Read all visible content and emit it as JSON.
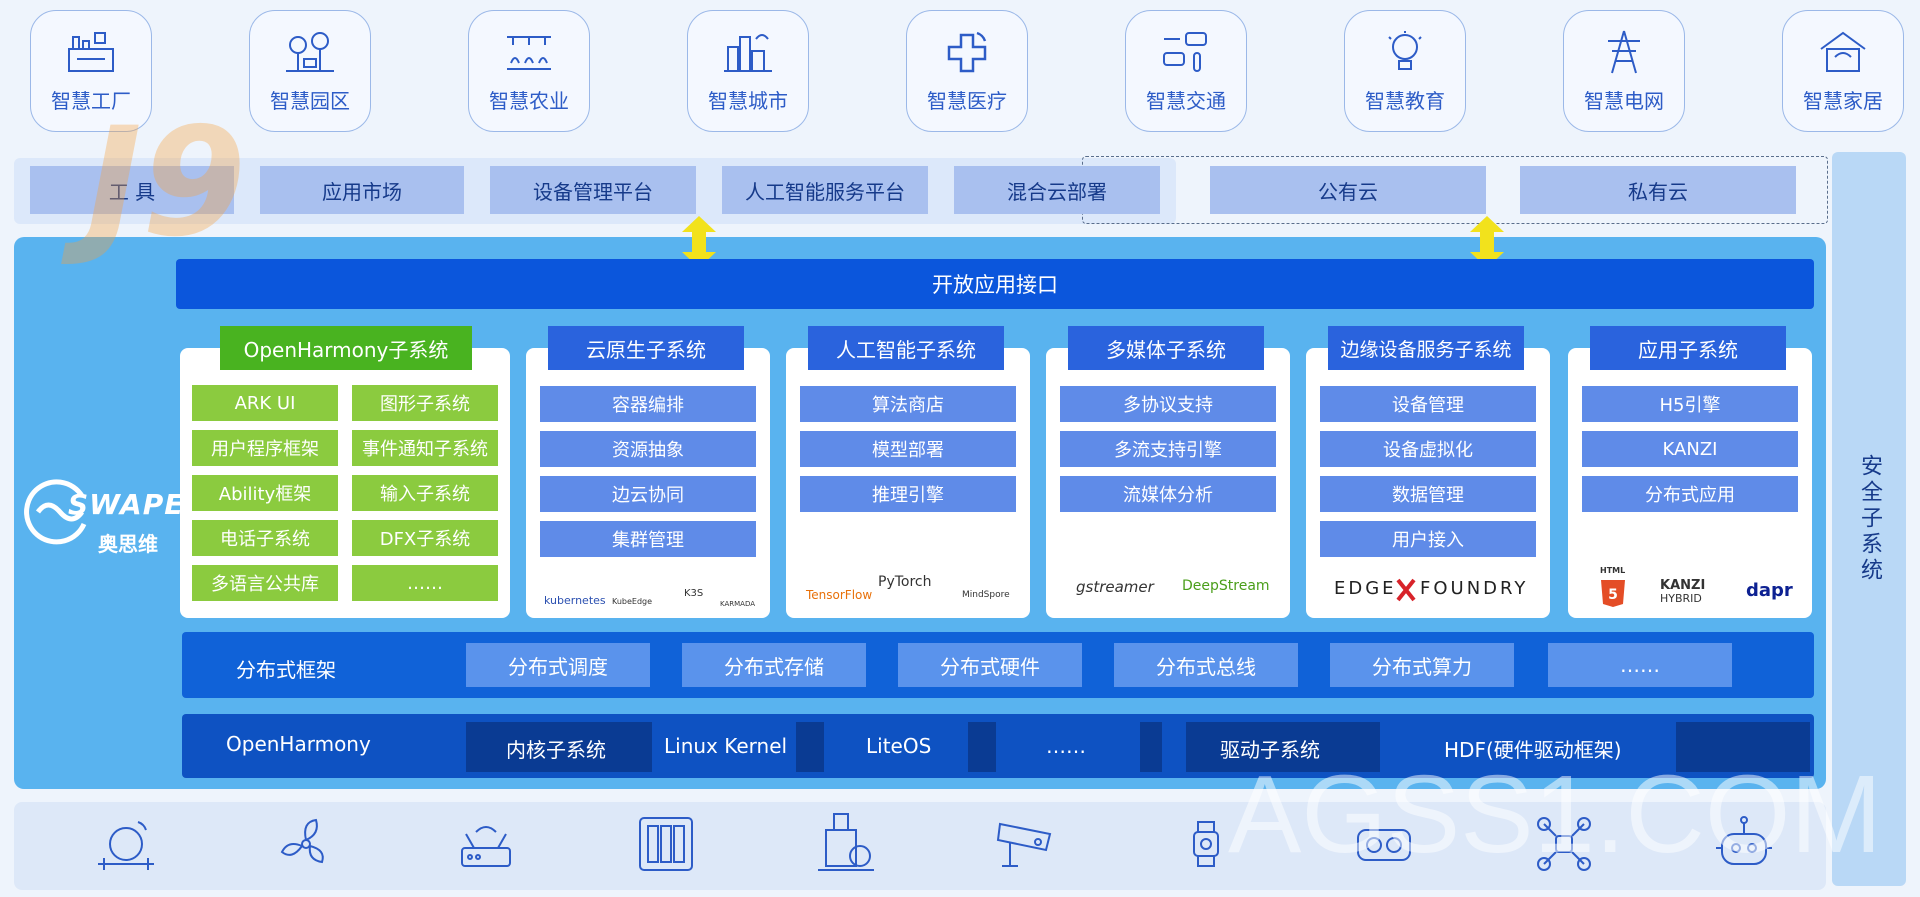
{
  "industries": [
    "智慧工厂",
    "智慧园区",
    "智慧农业",
    "智慧城市",
    "智慧医疗",
    "智慧交通",
    "智慧教育",
    "智慧电网",
    "智慧家居"
  ],
  "cloud_row": {
    "tools": "工 具",
    "app_market": "应用市场",
    "device_platform": "设备管理平台",
    "ai_platform": "人工智能服务平台",
    "hybrid": "混合云部署",
    "public_cloud": "公有云",
    "private_cloud": "私有云"
  },
  "security": "安全子系统",
  "api": "开放应用接口",
  "brand": {
    "logo": "SWAPE",
    "cn": "奥思维"
  },
  "openharmony_subsystem": {
    "title": "OpenHarmony子系统",
    "items": [
      "ARK UI",
      "图形子系统",
      "用户程序框架",
      "事件通知子系统",
      "Ability框架",
      "输入子系统",
      "电话子系统",
      "DFX子系统",
      "多语言公共库",
      "……"
    ]
  },
  "cloud_native": {
    "title": "云原生子系统",
    "items": [
      "容器编排",
      "资源抽象",
      "边云协同",
      "集群管理"
    ],
    "logos": [
      "kubernetes",
      "KubeEdge",
      "K3S",
      "KARMADA"
    ]
  },
  "ai_subsystem": {
    "title": "人工智能子系统",
    "items": [
      "算法商店",
      "模型部署",
      "推理引擎"
    ],
    "logos": [
      "TensorFlow",
      "PyTorch",
      "MindSpore"
    ]
  },
  "multimedia": {
    "title": "多媒体子系统",
    "items": [
      "多协议支持",
      "多流支持引擎",
      "流媒体分析"
    ],
    "logos": [
      "gstreamer",
      "DeepStream"
    ]
  },
  "edge_service": {
    "title": "边缘设备服务子系统",
    "items": [
      "设备管理",
      "设备虚拟化",
      "数据管理",
      "用户接入"
    ],
    "logos": [
      "EDGE",
      "FOUNDRY"
    ]
  },
  "app_subsystem": {
    "title": "应用子系统",
    "items": [
      "H5引擎",
      "KANZI",
      "分布式应用"
    ],
    "logos": [
      "HTML",
      "KANZI",
      "HYBRID",
      "dapr"
    ]
  },
  "distributed": {
    "label": "分布式框架",
    "items": [
      "分布式调度",
      "分布式存储",
      "分布式硬件",
      "分布式总线",
      "分布式算力",
      "……"
    ]
  },
  "openharmony": {
    "label": "OpenHarmony",
    "kernel": "内核子系统",
    "linux": "Linux Kernel",
    "liteos": "LiteOS",
    "more": "……",
    "driver": "驱动子系统",
    "hdf": "HDF(硬件驱动框架)"
  },
  "devices": [
    "meter-icon",
    "fan-icon",
    "router-icon",
    "server-icon",
    "meter-cabinet-icon",
    "camera-icon",
    "watch-icon",
    "vr-headset-icon",
    "drone-icon",
    "robot-icon"
  ],
  "watermark": {
    "corner": "J9",
    "main": "AGSS1.COM"
  },
  "colors": {
    "accent": "#0b56dc",
    "panel": "#59b3ef",
    "green": "#49b320",
    "item": "#5f8be8"
  }
}
